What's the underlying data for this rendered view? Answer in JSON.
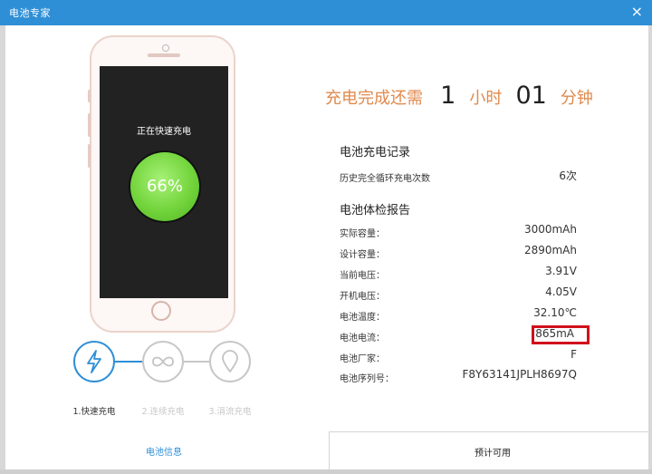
{
  "window": {
    "title": "电池专家",
    "close_symbol": "×"
  },
  "phone": {
    "status_text": "正在快速充电",
    "battery_percent": "66%"
  },
  "steps": [
    {
      "label": "1.快速充电",
      "icon": "lightning-icon",
      "active": true
    },
    {
      "label": "2.连续充电",
      "icon": "infinity-icon",
      "active": false
    },
    {
      "label": "3.涓流充电",
      "icon": "drop-icon",
      "active": false
    }
  ],
  "remaining": {
    "prefix": "充电完成还需",
    "hours": "1",
    "hours_unit": "小时",
    "minutes": "01",
    "minutes_unit": "分钟"
  },
  "charge_record": {
    "title": "电池充电记录",
    "rows": [
      {
        "label": "历史完全循环充电次数",
        "value": "6次"
      }
    ]
  },
  "health_report": {
    "title": "电池体检报告",
    "rows": [
      {
        "label": "实际容量：",
        "value": "3000mAh"
      },
      {
        "label": "设计容量：",
        "value": "2890mAh"
      },
      {
        "label": "当前电压：",
        "value": "3.91V"
      },
      {
        "label": "开机电压：",
        "value": "4.05V"
      },
      {
        "label": "电池温度：",
        "value": "32.10℃"
      },
      {
        "label": "电池电流：",
        "value": "865mA"
      },
      {
        "label": "电池厂家：",
        "value": "F"
      },
      {
        "label": "电池序列号：",
        "value": "F8Y63141JPLH8697Q"
      }
    ]
  },
  "bottom": {
    "battery_info": "电池信息",
    "estimated": "预计可用"
  },
  "colors": {
    "accent": "#2f8fd6",
    "orange": "#e08a4e",
    "highlight": "#d0101b",
    "battery_green": "#73d43c"
  }
}
